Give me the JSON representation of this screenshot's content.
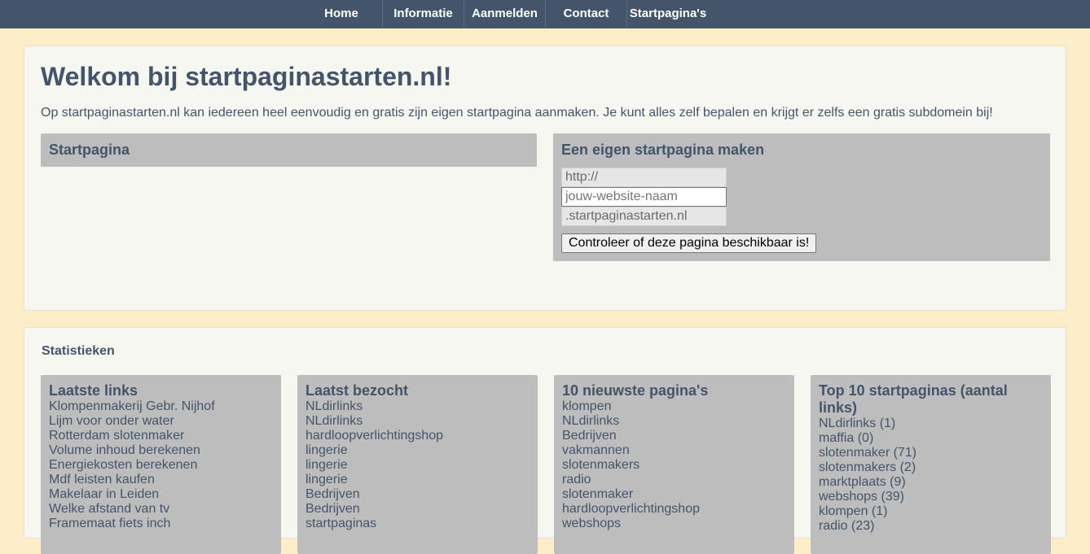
{
  "nav": {
    "items": [
      "Home",
      "Informatie",
      "Aanmelden",
      "Contact",
      "Startpagina's"
    ]
  },
  "welcome": {
    "title": "Welkom bij startpaginastarten.nl!",
    "intro": "Op startpaginastarten.nl kan iedereen heel eenvoudig en gratis zijn eigen startpagina aanmaken. Je kunt alles zelf bepalen en krijgt er zelfs een gratis subdomein bij!"
  },
  "startpagina_box": {
    "title": "Startpagina"
  },
  "maken_box": {
    "title": "Een eigen startpagina maken",
    "prefix_value": "http://",
    "name_placeholder": "jouw-website-naam",
    "suffix_value": ".startpaginastarten.nl",
    "button_label": "Controleer of deze pagina beschikbaar is!"
  },
  "stats": {
    "heading": "Statistieken",
    "columns": [
      {
        "title": "Laatste links",
        "items": [
          "Klompenmakerij Gebr. Nijhof",
          "Lijm voor onder water",
          "Rotterdam slotenmaker",
          "Volume inhoud berekenen",
          "Energiekosten berekenen",
          "Mdf leisten kaufen",
          "Makelaar in Leiden",
          "Welke afstand van tv",
          "Framemaat fiets inch"
        ]
      },
      {
        "title": "Laatst bezocht",
        "items": [
          "NLdirlinks",
          "NLdirlinks",
          "hardloopverlichtingshop",
          "lingerie",
          "lingerie",
          "lingerie",
          "Bedrijven",
          "Bedrijven",
          "startpaginas"
        ]
      },
      {
        "title": "10 nieuwste pagina's",
        "items": [
          "klompen",
          "NLdirlinks",
          "Bedrijven",
          "vakmannen",
          "slotenmakers",
          "radio",
          "slotenmaker",
          "hardloopverlichtingshop",
          "webshops"
        ]
      },
      {
        "title": "Top 10 startpaginas (aantal links)",
        "items": [
          "NLdirlinks (1)",
          "maffia (0)",
          "slotenmaker (71)",
          "slotenmakers (2)",
          "marktplaats (9)",
          "webshops (39)",
          "klompen (1)",
          "radio (23)"
        ]
      }
    ]
  },
  "colors": {
    "nav_bg": "#44546a",
    "page_bg": "#fdedc8",
    "panel_bg": "#f7f7f2",
    "box_bg": "#bdbdbd",
    "text": "#44546a"
  }
}
